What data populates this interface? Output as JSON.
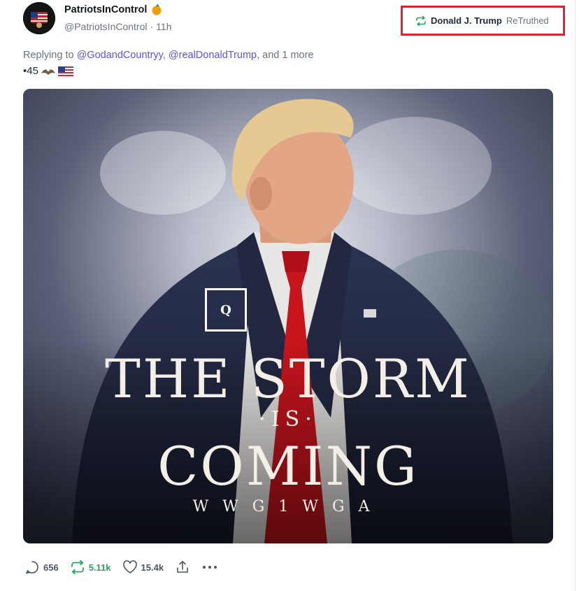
{
  "post": {
    "display_name": "PatriotsInControl",
    "handle": "@PatriotsInControl",
    "separator": "·",
    "time": "11h",
    "verified_icon": "verified-orange-badge"
  },
  "retruth": {
    "icon": "retruth-icon",
    "name": "Donald J. Trump",
    "label": "ReTruthed"
  },
  "reply": {
    "prefix": "Replying to",
    "mention1": "@GodandCountryy",
    "comma": ",",
    "mention2": "@realDonaldTrump",
    "suffix": ", and 1 more"
  },
  "body": {
    "text": "•45"
  },
  "image": {
    "q_label": "Q",
    "line1": "THE STORM",
    "line2": "·IS·",
    "line3": "COMING",
    "line4": "WWG1WGA"
  },
  "actions": {
    "replies": "656",
    "retruths": "5.11k",
    "likes": "15.4k"
  },
  "colors": {
    "accent_retruth": "#23a559",
    "highlight_border": "#d8262f",
    "mention": "#5b54d6"
  }
}
